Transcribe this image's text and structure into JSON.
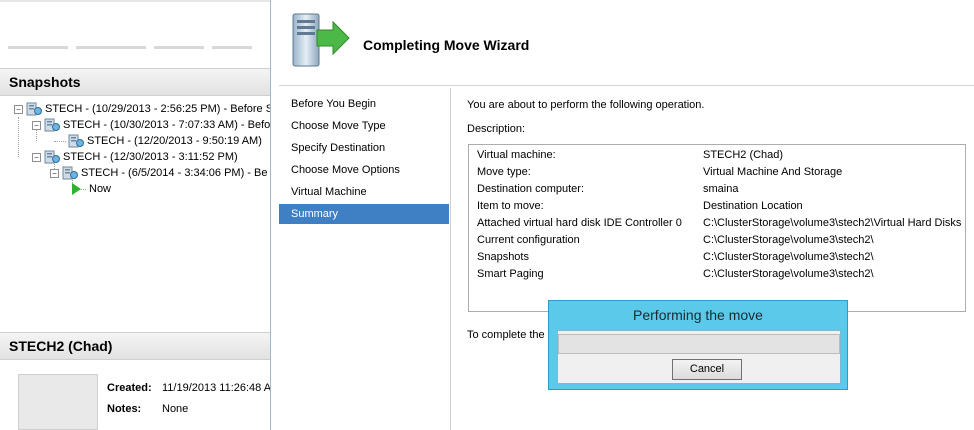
{
  "manager": {
    "snapshots_header": "Snapshots",
    "vm_header": "STECH2 (Chad)",
    "tree": [
      {
        "label": "STECH - (10/29/2013 - 2:56:25 PM) - Before S",
        "level": 0,
        "expander": "−"
      },
      {
        "label": "STECH - (10/30/2013 - 7:07:33 AM) - Befo",
        "level": 1,
        "expander": "−"
      },
      {
        "label": "STECH - (12/20/2013 - 9:50:19 AM)",
        "level": 2,
        "expander": ""
      },
      {
        "label": "STECH - (12/30/2013 - 3:11:52 PM)",
        "level": 1,
        "expander": "−"
      },
      {
        "label": "STECH - (6/5/2014 - 3:34:06 PM) - Be",
        "level": 2,
        "expander": "−"
      },
      {
        "label": "Now",
        "level": 3,
        "expander": "",
        "icon": "now-arrow-icon"
      }
    ],
    "details": {
      "created_label": "Created:",
      "created_value": "11/19/2013 11:26:48 A",
      "notes_label": "Notes:",
      "notes_value": "None"
    }
  },
  "wizard": {
    "title": "Completing Move Wizard",
    "nav": [
      {
        "label": "Before You Begin",
        "active": false
      },
      {
        "label": "Choose Move Type",
        "active": false
      },
      {
        "label": "Specify Destination",
        "active": false
      },
      {
        "label": "Choose Move Options",
        "active": false
      },
      {
        "label": "Virtual Machine",
        "active": false
      },
      {
        "label": "Summary",
        "active": true
      }
    ],
    "intro": "You are about to perform the following operation.",
    "description_label": "Description:",
    "rows": [
      {
        "label": "Virtual machine:",
        "value": "STECH2 (Chad)"
      },
      {
        "label": "Move type:",
        "value": "Virtual Machine And Storage"
      },
      {
        "label": "Destination computer:",
        "value": "smaina"
      },
      {
        "label": "Item to move:",
        "value": "Destination Location"
      },
      {
        "label": "Attached virtual hard disk  IDE Controller 0",
        "value": "C:\\ClusterStorage\\volume3\\stech2\\Virtual Hard Disks"
      },
      {
        "label": "Current configuration",
        "value": "C:\\ClusterStorage\\volume3\\stech2\\"
      },
      {
        "label": "Snapshots",
        "value": "C:\\ClusterStorage\\volume3\\stech2\\"
      },
      {
        "label": "Smart Paging",
        "value": "C:\\ClusterStorage\\volume3\\stech2\\"
      }
    ],
    "complete_text": "To complete the n"
  },
  "progress": {
    "title": "Performing the move",
    "cancel_label": "Cancel",
    "fraction": 0.0
  },
  "colors": {
    "nav_active": "#3f7fc4",
    "dialog_frame": "#5bc9ea",
    "progress_fill": "#06b025"
  }
}
